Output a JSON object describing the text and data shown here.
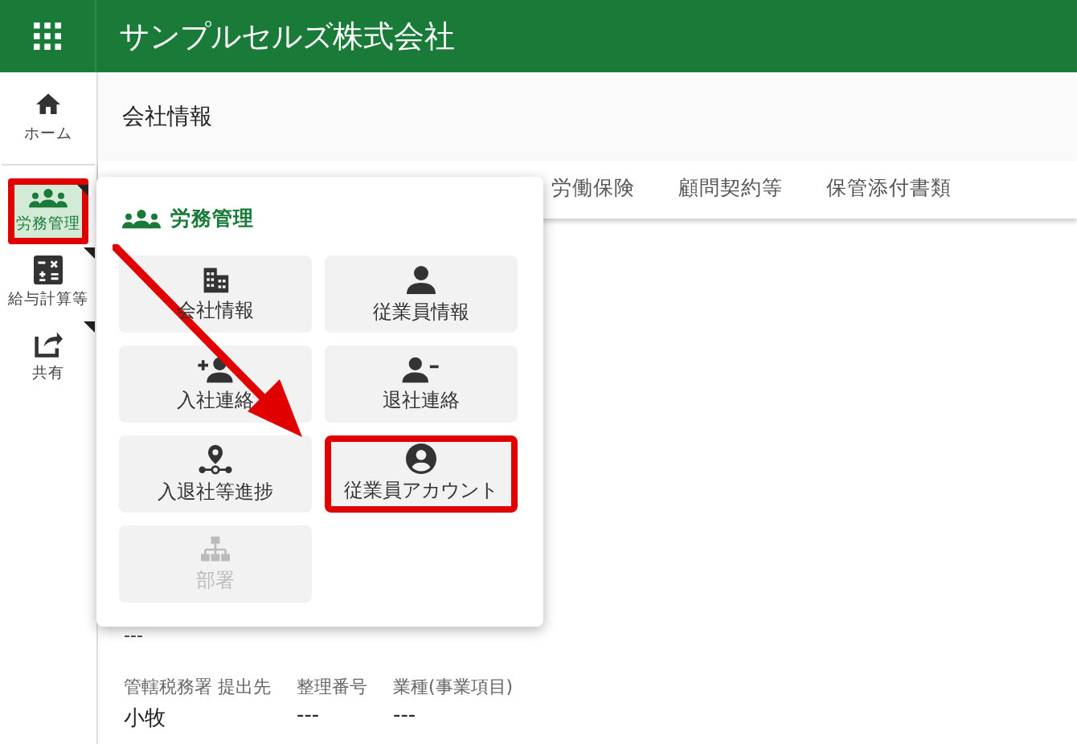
{
  "header": {
    "title": "サンプルセルズ株式会社"
  },
  "sidebar": {
    "items": [
      {
        "kind": "home",
        "label": "ホーム",
        "selected": false,
        "highlighted": false,
        "submenu": false
      },
      {
        "kind": "people",
        "label": "労務管理",
        "selected": true,
        "highlighted": true,
        "submenu": true
      },
      {
        "kind": "calc",
        "label": "給与計算等",
        "selected": false,
        "highlighted": false,
        "submenu": true
      },
      {
        "kind": "share",
        "label": "共有",
        "selected": false,
        "highlighted": false,
        "submenu": true
      }
    ]
  },
  "page_title": "会社情報",
  "tabs": [
    {
      "label": "労働保険",
      "selected": false
    },
    {
      "label": "顧問契約等",
      "selected": false
    },
    {
      "label": "保管添付書類",
      "selected": false
    }
  ],
  "popup": {
    "title": "労務管理",
    "tiles": [
      {
        "kind": "building",
        "label": "会社情報",
        "disabled": false,
        "highlighted": false
      },
      {
        "kind": "person",
        "label": "従業員情報",
        "disabled": false,
        "highlighted": false
      },
      {
        "kind": "person-add",
        "label": "入社連絡",
        "disabled": false,
        "highlighted": false
      },
      {
        "kind": "person-remove",
        "label": "退社連絡",
        "disabled": false,
        "highlighted": false
      },
      {
        "kind": "progress",
        "label": "入退社等進捗",
        "disabled": false,
        "highlighted": false
      },
      {
        "kind": "account",
        "label": "従業員アカウント",
        "disabled": false,
        "highlighted": true
      },
      {
        "kind": "org",
        "label": "部署",
        "disabled": true,
        "highlighted": false
      }
    ]
  },
  "above_value": "---",
  "fields": [
    {
      "label": "管轄税務署 提出先",
      "value": "小牧"
    },
    {
      "label": "整理番号",
      "value": "---"
    },
    {
      "label": "業種(事業項目)",
      "value": "---"
    }
  ]
}
